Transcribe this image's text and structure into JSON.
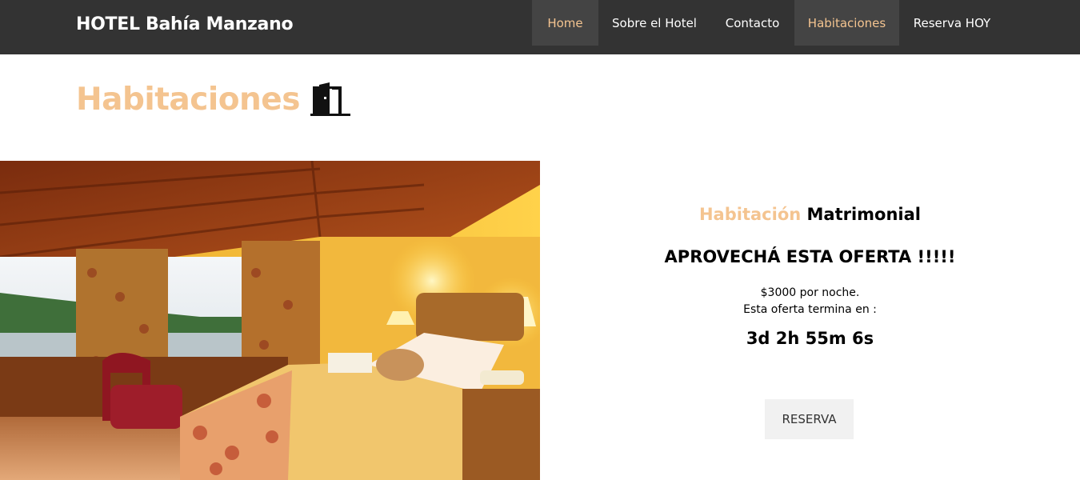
{
  "brand": "HOTEL Bahía Manzano",
  "nav": {
    "home": "Home",
    "about": "Sobre el Hotel",
    "contact": "Contacto",
    "rooms": "Habitaciones",
    "book": "Reserva HOY"
  },
  "page": {
    "title": "Habitaciones",
    "title_icon": "door-icon"
  },
  "offer": {
    "room_prefix": "Habitación",
    "room_suffix": "Matrimonial",
    "headline": "APROVECHÁ ESTA OFERTA !!!!!",
    "price": "$3000 por noche.",
    "ends_label": "Esta oferta termina en :",
    "countdown": "3d 2h 55m 6s",
    "button": "RESERVA"
  },
  "colors": {
    "navbar": "#333333",
    "accent": "#f4c490",
    "active_tab": "#444444",
    "button_bg": "#f1f1f1"
  }
}
